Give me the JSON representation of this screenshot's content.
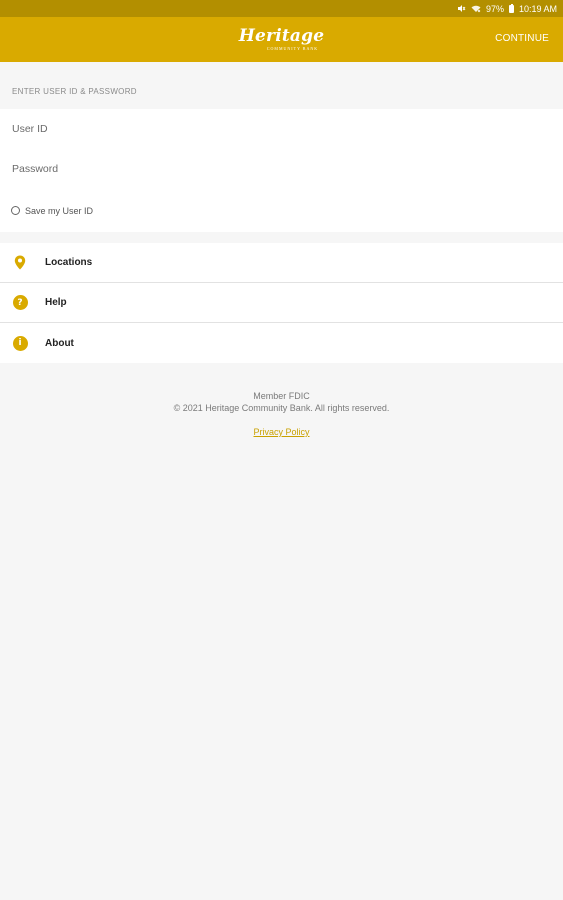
{
  "status_bar": {
    "battery": "97%",
    "time": "10:19 AM"
  },
  "app_bar": {
    "logo_text": "Heritage",
    "logo_subtext": "COMMUNITY BANK",
    "continue_label": "CONTINUE"
  },
  "login": {
    "section_title": "ENTER USER ID & PASSWORD",
    "user_id_placeholder": "User ID",
    "password_placeholder": "Password",
    "save_label": "Save my User ID"
  },
  "menu": {
    "items": [
      {
        "label": "Locations",
        "icon": "map-pin-icon"
      },
      {
        "label": "Help",
        "icon": "question-icon"
      },
      {
        "label": "About",
        "icon": "info-icon"
      }
    ]
  },
  "footer": {
    "member": "Member FDIC",
    "copyright": "© 2021 Heritage Community Bank. All rights reserved.",
    "privacy_label": "Privacy Policy"
  },
  "colors": {
    "brand": "#d9aa00",
    "status_bar": "#b38f00",
    "link": "#c9a100",
    "background": "#f6f6f6"
  }
}
